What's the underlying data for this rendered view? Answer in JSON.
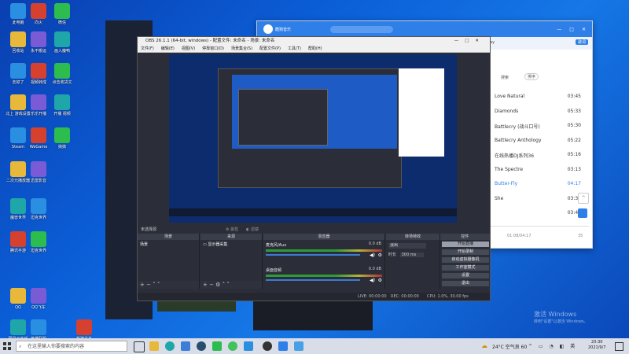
{
  "desktop_icons": [
    {
      "label": "此电脑"
    },
    {
      "label": "向火"
    },
    {
      "label": "微信"
    },
    {
      "label": "回收站"
    },
    {
      "label": "永不搬运"
    },
    {
      "label": "画入魔鸭"
    },
    {
      "label": "去掉了"
    },
    {
      "label": "视频转成"
    },
    {
      "label": "点击收货文"
    },
    {
      "label": "北上 游戏设置"
    },
    {
      "label": "乐乐开播"
    },
    {
      "label": "开播 视频"
    },
    {
      "label": "Steam"
    },
    {
      "label": "WeGame"
    },
    {
      "label": "搞搞"
    },
    {
      "label": "二次元播放器"
    },
    {
      "label": "迅雷影音"
    },
    {
      "label": "魔兽世界"
    },
    {
      "label": "坦克世界"
    },
    {
      "label": "腾讯手游"
    },
    {
      "label": "坦克世界"
    },
    {
      "label": "QQ"
    },
    {
      "label": "QQ飞车"
    },
    {
      "label": "网易云音乐"
    },
    {
      "label": "英雄联盟"
    },
    {
      "label": "新建文本"
    }
  ],
  "music": {
    "app_name": "酷狗音乐",
    "search_placeholder": "搜索",
    "tab_label": "ay",
    "sort_btn": "搜索",
    "sort_btn2": "排序",
    "close_label": "歌词",
    "songs": [
      {
        "title": "Love Natural",
        "dur": "03:45"
      },
      {
        "title": "Diamonds",
        "dur": "05:33"
      },
      {
        "title": "Battlecry (战斗口号)",
        "dur": "05:30"
      },
      {
        "title": "Battlecry Anthology",
        "dur": "05:22"
      },
      {
        "title": "在线热播DJ系列36",
        "dur": "05:16"
      },
      {
        "title": "The Spectre",
        "dur": "03:13"
      },
      {
        "title": "Butter-Fly",
        "dur": "04:17"
      },
      {
        "title": "She",
        "dur": "03:36"
      },
      {
        "title": "",
        "dur": "03:47"
      }
    ],
    "progress_time": "01:08/04:17",
    "volume": "35"
  },
  "obs": {
    "title": "OBS 26.1.1 (64-bit, windows) - 配置文件: 未命名 - 场景: 未命名",
    "menu": [
      "文件(F)",
      "编辑(E)",
      "视图(V)",
      "停靠窗口(D)",
      "场景集合(S)",
      "配置文件(P)",
      "工具(T)",
      "帮助(H)"
    ],
    "no_source": "未选择源",
    "props_btn": "属性",
    "filter_btn": "滤镜",
    "docks": {
      "scenes": "场景",
      "sources": "来源",
      "mixer": "混音器",
      "transitions": "转场特效",
      "controls": "控件"
    },
    "scene_item": "场景",
    "source_item": "显示器采集",
    "mixer_channels": [
      {
        "name": "麦克风/Aux",
        "db": "0.0 dB"
      },
      {
        "name": "桌面音频",
        "db": "0.0 dB"
      }
    ],
    "transition_type": "淡出",
    "duration_label": "时长",
    "duration_value": "300 ms",
    "controls": [
      "开始直播",
      "开始录制",
      "启动虚拟摄像机",
      "工作室模式",
      "设置",
      "退出"
    ],
    "status": {
      "live": "LIVE: 00:00:00",
      "rec": "REC: 00:00:00",
      "cpu": "CPU: 1.0%, 30.00 fps"
    }
  },
  "watermark": {
    "line1": "激活 Windows",
    "line2": "转到\"设置\"以激活 Windows。"
  },
  "taskbar": {
    "search_placeholder": "在这里输入你要搜索的内容",
    "weather": "24°C 空气良 60",
    "time": "20:30",
    "date": "2021/9/7"
  },
  "colors": {
    "accent": "#2f7fe8",
    "obs_bg": "#2b2e38",
    "desktop": "#0b5fd8",
    "live": "#3a7bd5"
  }
}
